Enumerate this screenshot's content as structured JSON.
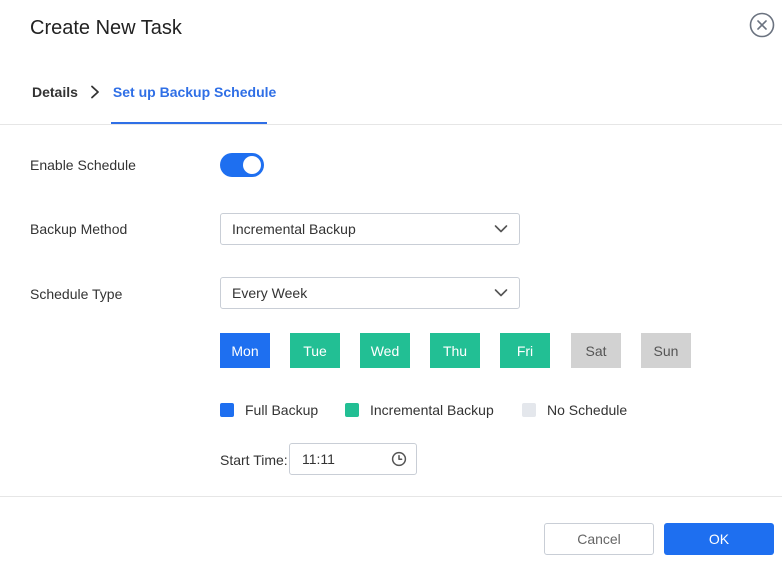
{
  "dialog": {
    "title": "Create New Task",
    "close_icon": "close-circle-icon"
  },
  "steps": {
    "items": [
      "Details",
      "Set up Backup Schedule"
    ],
    "active_index": 1,
    "separator_icon": "chevron-right-icon"
  },
  "form": {
    "enable_schedule": {
      "label": "Enable Schedule",
      "value": true
    },
    "backup_method": {
      "label": "Backup Method",
      "value": "Incremental Backup",
      "icon": "chevron-down-icon"
    },
    "schedule_type": {
      "label": "Schedule Type",
      "value": "Every Week",
      "icon": "chevron-down-icon"
    },
    "days": [
      {
        "label": "Mon",
        "status": "full"
      },
      {
        "label": "Tue",
        "status": "incremental"
      },
      {
        "label": "Wed",
        "status": "incremental"
      },
      {
        "label": "Thu",
        "status": "incremental"
      },
      {
        "label": "Fri",
        "status": "incremental"
      },
      {
        "label": "Sat",
        "status": "none"
      },
      {
        "label": "Sun",
        "status": "none"
      }
    ],
    "legend": [
      {
        "label": "Full Backup",
        "status": "full"
      },
      {
        "label": "Incremental Backup",
        "status": "incremental"
      },
      {
        "label": "No Schedule",
        "status": "none"
      }
    ],
    "start_time": {
      "label": "Start Time:",
      "value": "11:11",
      "icon": "clock-icon"
    }
  },
  "colors": {
    "accent": "#2f6fe6",
    "full": "#1e6ff0",
    "incremental": "#22bf94",
    "none_day": "#d2d2d2",
    "none_legend": "#e4e7ec"
  },
  "footer": {
    "cancel_label": "Cancel",
    "ok_label": "OK"
  }
}
